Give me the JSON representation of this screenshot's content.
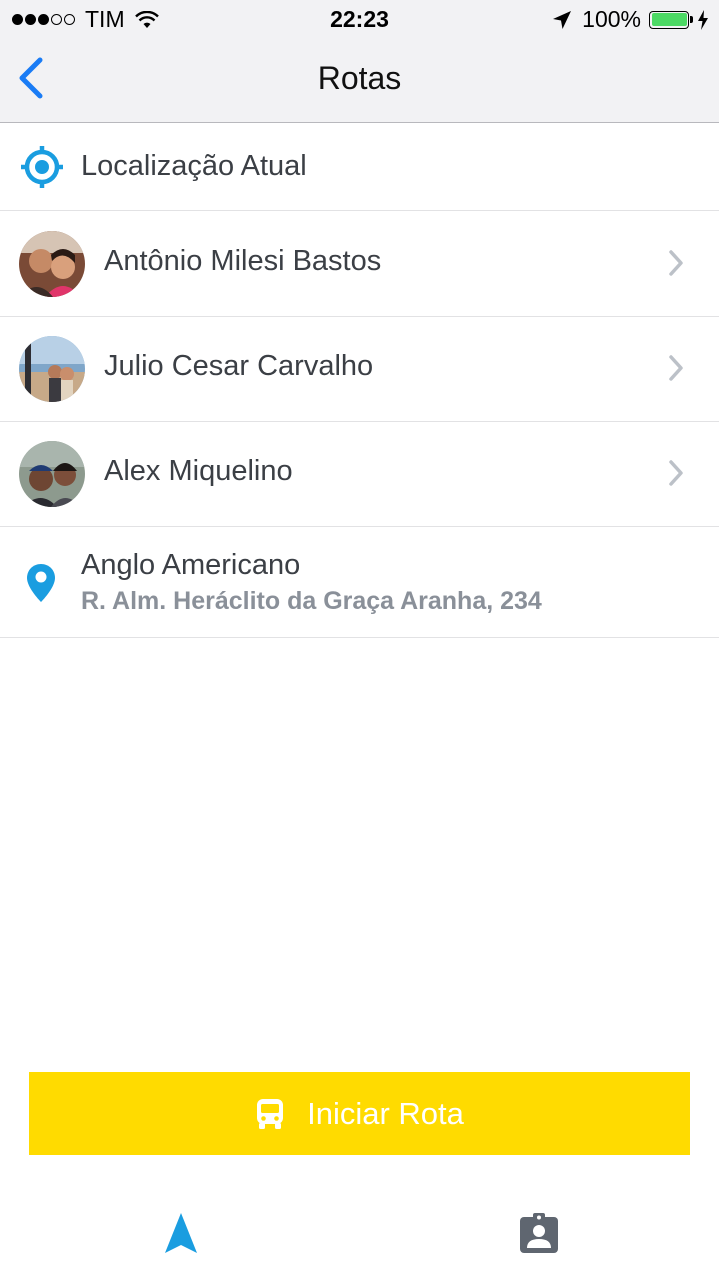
{
  "status": {
    "carrier": "TIM",
    "time": "22:23",
    "battery": "100%",
    "signal_bars_filled": 3,
    "signal_bars_total": 5
  },
  "header": {
    "title": "Rotas",
    "back_icon": "chevron-left-icon"
  },
  "current_location": {
    "label": "Localização Atual",
    "icon": "target-icon"
  },
  "passengers": [
    {
      "name": "Antônio Milesi Bastos"
    },
    {
      "name": "Julio Cesar Carvalho"
    },
    {
      "name": "Alex Miquelino"
    }
  ],
  "destination": {
    "name": "Anglo Americano",
    "address": "R. Alm. Heráclito da Graça Aranha, 234",
    "icon": "map-pin-icon"
  },
  "start_button": {
    "label": "Iniciar Rota",
    "icon": "bus-icon"
  },
  "tabs": [
    {
      "icon": "navigation-arrow-icon",
      "active": true
    },
    {
      "icon": "profile-badge-icon",
      "active": false
    }
  ],
  "colors": {
    "accent": "#1a9de0",
    "button": "#ffdb00",
    "ios_blue": "#1a7cf5"
  }
}
